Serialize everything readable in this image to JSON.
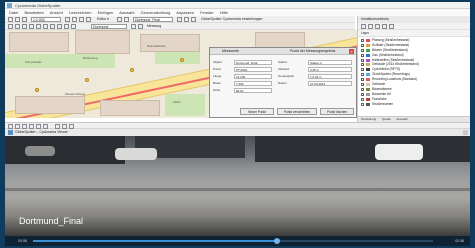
{
  "window": {
    "title": "Cyclomedia GlobeSpotter",
    "menu": [
      "Datei",
      "Bearbeiten",
      "Ansicht",
      "Lesezeichen",
      "Einfügen",
      "Auswahl",
      "Geoverarbeitung",
      "Anpassen",
      "Fenster",
      "Hilfe"
    ]
  },
  "toolbar": {
    "scale_value": "1:2.000",
    "layer_combo": "Dortmund_Final",
    "editor_label": "Editor ▾",
    "georef_combo": "Dortmund",
    "measure_label": "Messung",
    "text_label": "GlobeSpotter Cyclomedia einstellungen"
  },
  "map": {
    "labels": [
      "Kampstraße",
      "Brüderweg",
      "Reinoldikirche",
      "Westenhellweg",
      "Markt"
    ]
  },
  "popup": {
    "title": "Messwerte",
    "subtitle": "Punkt der Messungsergebnis",
    "fields": [
      {
        "label": "Objekt",
        "value": "Dortmund_Final"
      },
      {
        "label": "Punkt",
        "value": "PT-0001"
      },
      {
        "label": "Länge",
        "value": "14,235"
      },
      {
        "label": "Breite",
        "value": "7,465"
      },
      {
        "label": "Höhe",
        "value": "82,61"
      }
    ],
    "right_fields": [
      {
        "label": "Station",
        "value": "Station 2"
      },
      {
        "label": "Abstand",
        "value": "3,25 m"
      },
      {
        "label": "Genauigkeit",
        "value": "± 0,02 m"
      },
      {
        "label": "Datum",
        "value": "27.03.2013"
      }
    ],
    "buttons": [
      "Neuer Punkt",
      "Punkt verschieben",
      "Punkt löschen"
    ]
  },
  "toc": {
    "title": "Inhaltsverzeichnis",
    "tab_header": "Layer",
    "layers": [
      {
        "name": "Planung (Straßenbestand)",
        "checked": true,
        "color": "#e44b4b"
      },
      {
        "name": "Schilder (Straßenbestand)",
        "checked": true,
        "color": "#e89a3a"
      },
      {
        "name": "Bäume (Straßenbestand)",
        "checked": true,
        "color": "#3aa64b"
      },
      {
        "name": "Gas (Straßenbestand)",
        "checked": true,
        "color": "#2f71c9"
      },
      {
        "name": "Haltestellen (Straßenbestand)",
        "checked": true,
        "color": "#b44bd6"
      },
      {
        "name": "Gebäude (2014 Straßenbestand)",
        "checked": true,
        "color": "#c9a76c"
      },
      {
        "name": "CycloMedia (RPTS)",
        "checked": true,
        "color": "#444444"
      },
      {
        "name": "GlobeSpotter (Recordings)",
        "checked": true,
        "color": "#5aa9e6"
      },
      {
        "name": "Recording Locations (Standard)",
        "checked": true,
        "color": "#e85a5a"
      },
      {
        "name": "Gebäude",
        "checked": true,
        "color": "#d9c3a4"
      },
      {
        "name": "Bäumstämme",
        "checked": true,
        "color": "#6a8e3a"
      },
      {
        "name": "Bauwerke Alt",
        "checked": true,
        "color": "#9a9a9a"
      },
      {
        "name": "Flurstücke",
        "checked": false,
        "color": "#c23b3b"
      },
      {
        "name": "Straßennamen",
        "checked": false,
        "color": "#555555"
      }
    ],
    "bottom_tabs": [
      "Darstellung",
      "Quelle",
      "Auswahl"
    ]
  },
  "viewer": {
    "title": "GlobeSpotter – Cyclorama Viewer",
    "photo_caption": "Dortmund_Final"
  },
  "statusbar": {
    "left": "00:08",
    "right": "02:36",
    "progress": 0.61
  },
  "colors": {
    "accent": "#3b8fd4",
    "track": "#ee6a6a",
    "background": "#0f3b5c"
  }
}
